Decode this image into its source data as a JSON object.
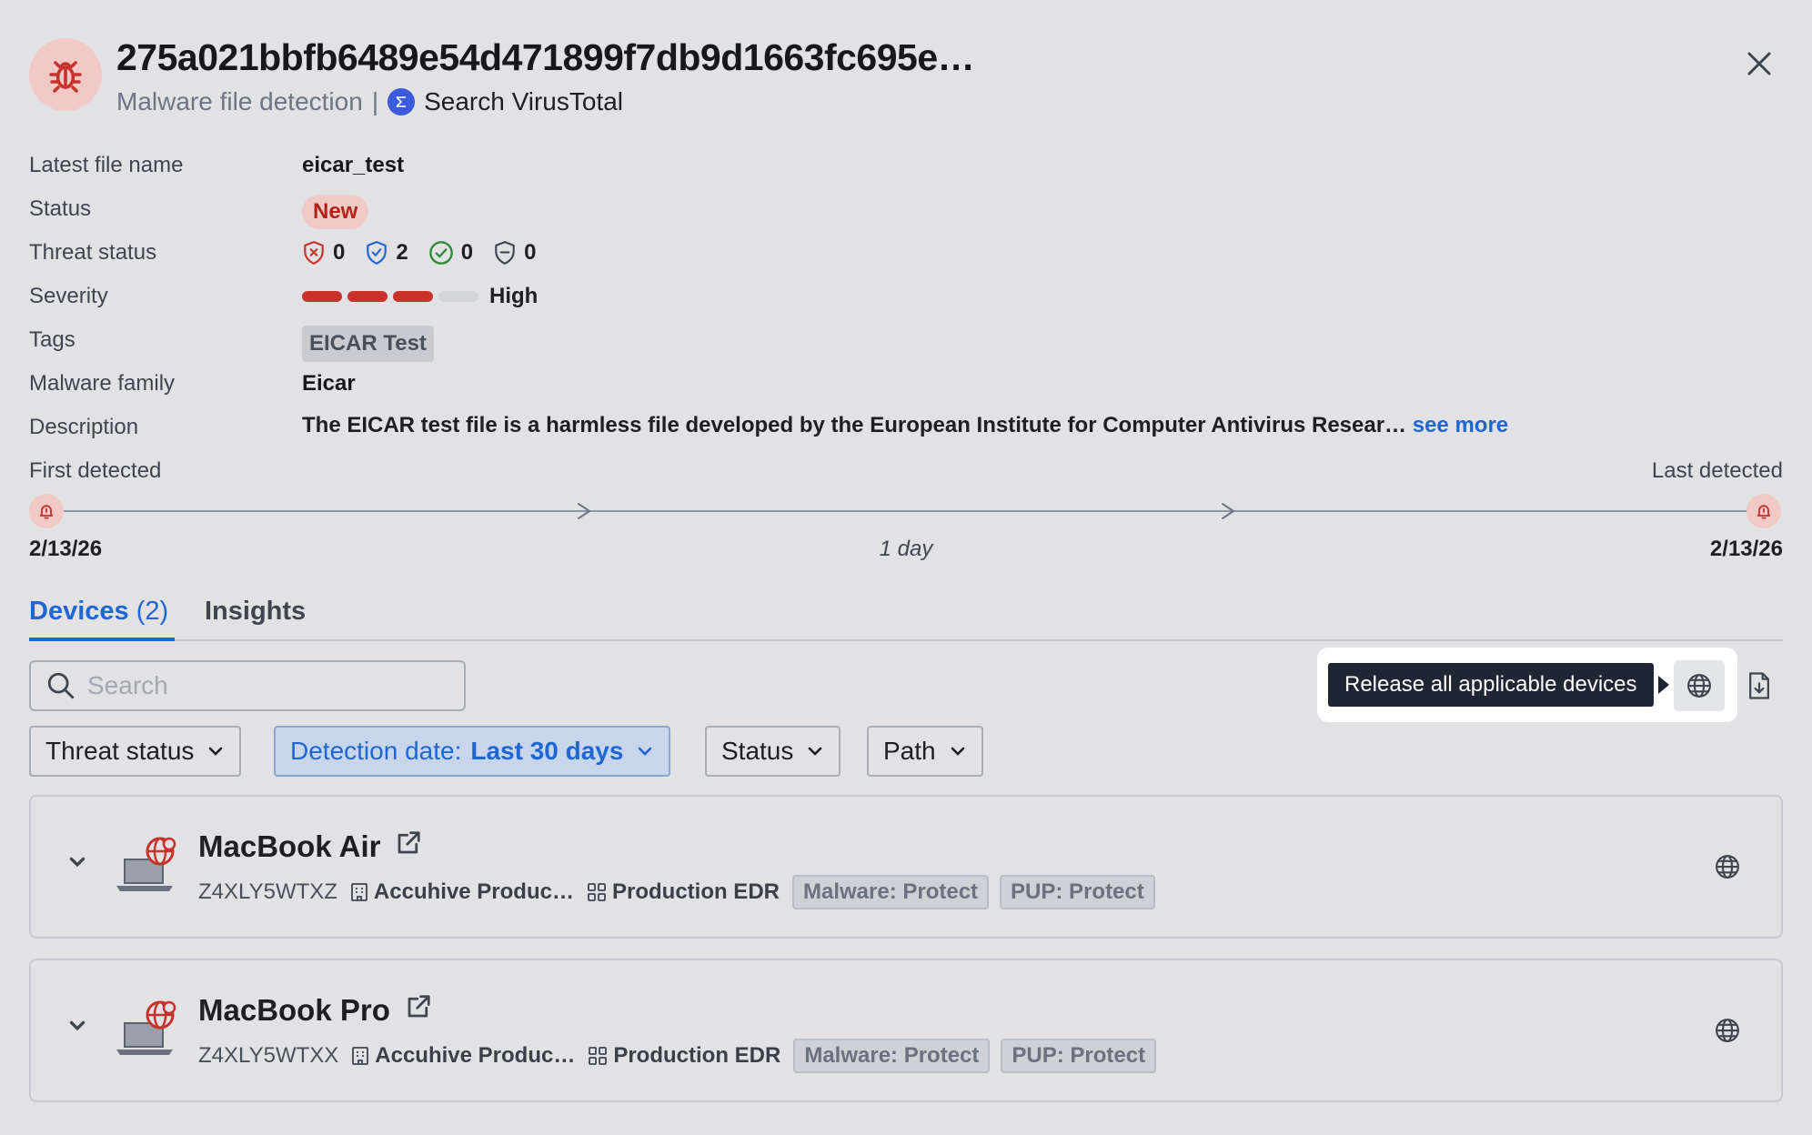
{
  "header": {
    "title": "275a021bbfb6489e54d471899f7db9d1663fc695e…",
    "subtitle": "Malware file detection",
    "separator": "|",
    "virustotal_label": "Search VirusTotal"
  },
  "details": {
    "latest_file_name": {
      "label": "Latest file name",
      "value": "eicar_test"
    },
    "status": {
      "label": "Status",
      "value": "New"
    },
    "threat_status": {
      "label": "Threat status",
      "counts": [
        {
          "icon": "shield-x-icon",
          "value": "0",
          "color": "#c7322b"
        },
        {
          "icon": "shield-check-icon",
          "value": "2",
          "color": "#1f66d1"
        },
        {
          "icon": "check-circle-icon",
          "value": "0",
          "color": "#2f8a3a"
        },
        {
          "icon": "shield-minus-icon",
          "value": "0",
          "color": "#3f4550"
        }
      ]
    },
    "severity": {
      "label": "Severity",
      "value": "High",
      "level": 3,
      "max": 4
    },
    "tags": {
      "label": "Tags",
      "value": "EICAR Test"
    },
    "malware_family": {
      "label": "Malware family",
      "value": "Eicar"
    },
    "description": {
      "label": "Description",
      "value": "The EICAR test file is a harmless file developed by the European Institute for Computer Antivirus Resear…",
      "see_more": "see more"
    }
  },
  "timeline": {
    "first_label": "First detected",
    "last_label": "Last detected",
    "first_date": "2/13/26",
    "last_date": "2/13/26",
    "duration": "1 day"
  },
  "tabs": {
    "devices_label": "Devices",
    "devices_count": "(2)",
    "insights_label": "Insights"
  },
  "toolbar": {
    "search_placeholder": "Search",
    "tooltip": "Release all applicable devices"
  },
  "filters": {
    "threat_status": "Threat status",
    "detection_date_label": "Detection date:",
    "detection_date_value": "Last 30 days",
    "status": "Status",
    "path": "Path"
  },
  "devices": [
    {
      "name": "MacBook Air",
      "serial": "Z4XLY5WTXZ",
      "org": "Accuhive Produc…",
      "group": "Production EDR",
      "malware_policy": "Malware: Protect",
      "pup_policy": "PUP: Protect"
    },
    {
      "name": "MacBook Pro",
      "serial": "Z4XLY5WTXX",
      "org": "Accuhive Produc…",
      "group": "Production EDR",
      "malware_policy": "Malware: Protect",
      "pup_policy": "PUP: Protect"
    }
  ],
  "colors": {
    "accent": "#1f66d1",
    "danger": "#c7322b",
    "background": "#e2e2e4"
  }
}
